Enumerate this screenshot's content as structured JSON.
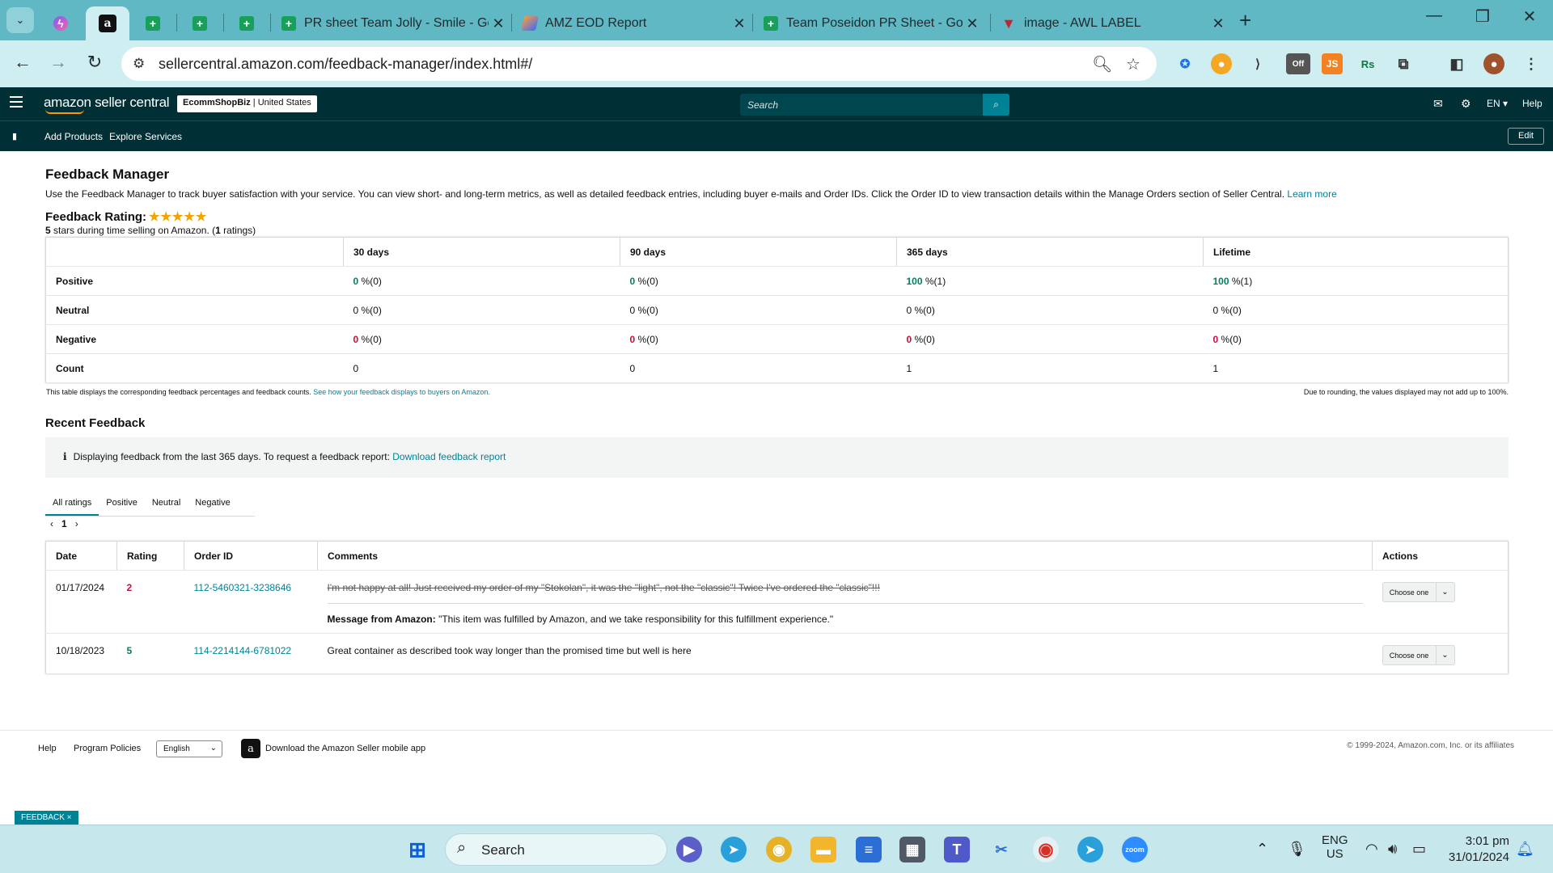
{
  "browser": {
    "tabs": [
      {
        "title": "PR sheet Team Jolly - Smile - Go"
      },
      {
        "title": "AMZ EOD Report"
      },
      {
        "title": "Team Poseidon PR Sheet - Goo"
      },
      {
        "title": "image - AWL LABEL"
      }
    ],
    "url": "sellercentral.amazon.com/feedback-manager/index.html#/"
  },
  "header": {
    "logo": "amazon seller central",
    "store_name": "EcommShopBiz",
    "store_region": "| United States",
    "search_placeholder": "Search",
    "lang": "EN",
    "help": "Help",
    "nav": [
      "Add Products",
      "Explore Services"
    ],
    "edit": "Edit"
  },
  "page": {
    "title": "Feedback Manager",
    "intro": "Use the Feedback Manager to track buyer satisfaction with your service. You can view short- and long-term metrics, as well as detailed feedback entries, including buyer e-mails and Order IDs. Click the Order ID to view transaction details within the Manage Orders section of Seller Central.",
    "learn_more": "Learn more",
    "rating_label": "Feedback Rating:",
    "stars": "★★★★★",
    "rating_sub_stars": "5",
    "rating_sub_text": " stars during time selling on Amazon. (",
    "rating_sub_count": "1",
    "rating_sub_end": " ratings)"
  },
  "metrics": {
    "columns": [
      "30 days",
      "90 days",
      "365 days",
      "Lifetime"
    ],
    "rows": [
      {
        "label": "Positive",
        "cells": [
          [
            "0",
            " %(0)"
          ],
          [
            "0",
            " %(0)"
          ],
          [
            "100",
            " %(1)"
          ],
          [
            "100",
            " %(1)"
          ]
        ]
      },
      {
        "label": "Neutral",
        "cells": [
          [
            "",
            "0 %(0)"
          ],
          [
            "",
            "0 %(0)"
          ],
          [
            "",
            "0 %(0)"
          ],
          [
            "",
            "0 %(0)"
          ]
        ]
      },
      {
        "label": "Negative",
        "cells": [
          [
            "0",
            " %(0)"
          ],
          [
            "0",
            " %(0)"
          ],
          [
            "0",
            " %(0)"
          ],
          [
            "0",
            " %(0)"
          ]
        ]
      },
      {
        "label": "Count",
        "cells": [
          [
            "",
            "0"
          ],
          [
            "",
            "0"
          ],
          [
            "",
            "1"
          ],
          [
            "",
            "1"
          ]
        ]
      }
    ],
    "note_left": "This table displays the corresponding feedback percentages and feedback counts.",
    "note_left_link": "See how your feedback displays to buyers on Amazon.",
    "note_right": "Due to rounding, the values displayed may not add up to 100%."
  },
  "recent": {
    "title": "Recent Feedback",
    "info": "Displaying feedback from the last 365 days. To request a feedback report:",
    "info_link": "Download feedback report",
    "tabs": [
      "All ratings",
      "Positive",
      "Neutral",
      "Negative"
    ],
    "page": "1",
    "columns": [
      "Date",
      "Rating",
      "Order ID",
      "Comments",
      "Actions"
    ],
    "rows": [
      {
        "date": "01/17/2024",
        "rating": "2",
        "order_id": "112-5460321-3238646",
        "comment": "I'm not happy at all! Just received my order of my \"Stokolan\", it was the \"light\", not the \"classic\"! Twice I've ordered the \"classic\"!!!",
        "amazon_msg_label": "Message from Amazon:",
        "amazon_msg": " \"This item was fulfilled by Amazon, and we take responsibility for this fulfillment experience.\"",
        "action": "Choose one"
      },
      {
        "date": "10/18/2023",
        "rating": "5",
        "order_id": "114-2214144-6781022",
        "comment": "Great container as described took way longer than the promised time but well is here",
        "action": "Choose one"
      }
    ]
  },
  "footer": {
    "help": "Help",
    "policies": "Program Policies",
    "language": "English",
    "app": "Download the Amazon Seller mobile app",
    "copyright": "© 1999-2024, Amazon.com, Inc. or its affiliates",
    "feedback_badge": "FEEDBACK ×"
  },
  "taskbar": {
    "search": "Search",
    "lang_top": "ENG",
    "lang_bottom": "US",
    "time": "3:01 pm",
    "date": "31/01/2024"
  },
  "colors": {
    "header_bg": "#002f36",
    "link": "#008296",
    "positive": "#067d62",
    "negative": "#cc0c39",
    "star": "#f0a500"
  }
}
